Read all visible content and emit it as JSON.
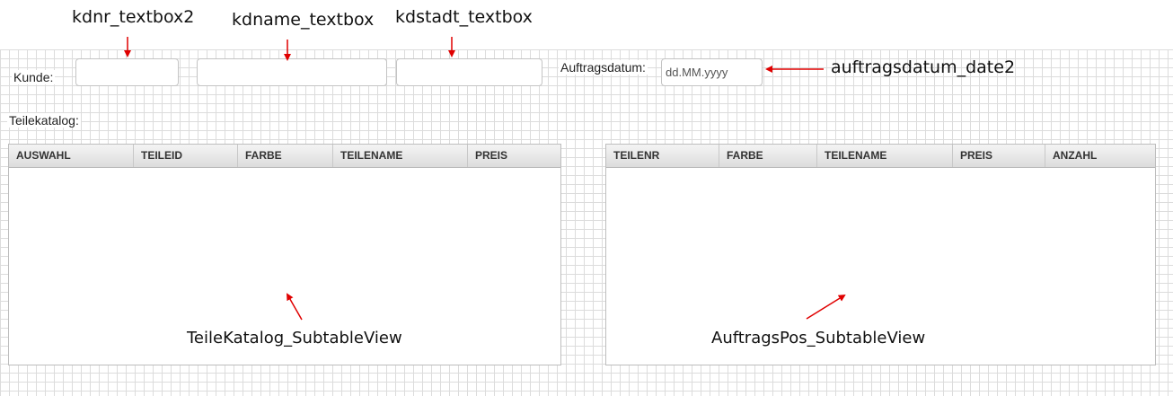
{
  "form": {
    "kunde_label": "Kunde:",
    "teilekatalog_label": "Teilekatalog:",
    "auftragsdatum_label": "Auftragsdatum:",
    "kdnr_value": "",
    "kdname_value": "",
    "kdstadt_value": "",
    "auftragsdatum_placeholder": "dd.MM.yyyy"
  },
  "teilekatalog_table": {
    "columns": [
      "AUSWAHL",
      "TEILEID",
      "FARBE",
      "TEILENAME",
      "PREIS"
    ]
  },
  "auftragspos_table": {
    "columns": [
      "TEILENR",
      "FARBE",
      "TEILENAME",
      "PREIS",
      "ANZAHL"
    ]
  },
  "annotations": {
    "kdnr": "kdnr_textbox2",
    "kdname": "kdname_textbox",
    "kdstadt": "kdstadt_textbox",
    "auftragsdatum": "auftragsdatum_date2",
    "teilekatalog": "TeileKatalog_SubtableView",
    "auftragspos": "AuftragsPos_SubtableView"
  },
  "colors": {
    "annotation_arrow": "#e00000",
    "grid_line": "#dcdcdc",
    "header_gradient_top": "#f4f4f4",
    "header_gradient_bottom": "#dcdcdc"
  }
}
